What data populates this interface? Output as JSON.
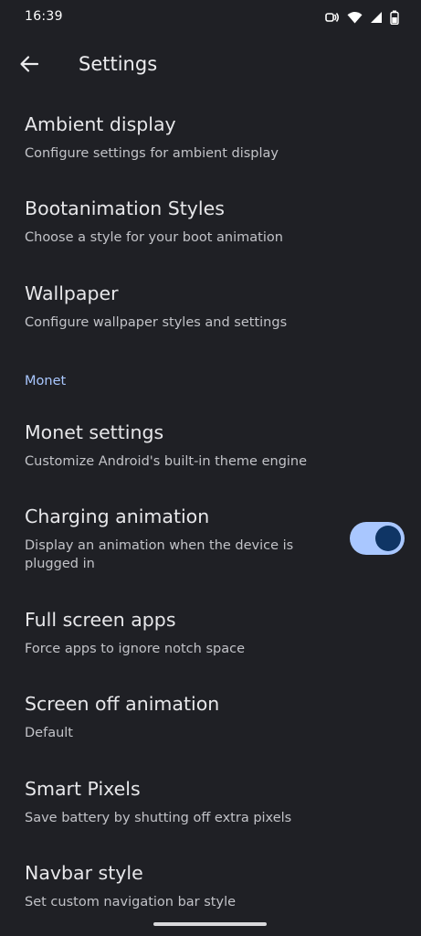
{
  "status_bar": {
    "time": "16:39",
    "icons": [
      "nfc-icon",
      "wifi-icon",
      "signal-icon",
      "battery-icon"
    ]
  },
  "toolbar": {
    "back_icon": "arrow-back-icon",
    "title": "Settings"
  },
  "preferences_top": [
    {
      "title": "Ambient display",
      "summary": "Configure settings for ambient display"
    },
    {
      "title": "Bootanimation Styles",
      "summary": "Choose a style for your boot animation"
    },
    {
      "title": "Wallpaper",
      "summary": "Configure wallpaper styles and settings"
    }
  ],
  "section": {
    "header": "Monet"
  },
  "preferences_monet": [
    {
      "title": "Monet settings",
      "summary": "Customize Android's built-in theme engine"
    },
    {
      "title": "Charging animation",
      "summary": "Display an animation when the device is plugged in",
      "switch_on": true
    },
    {
      "title": "Full screen apps",
      "summary": "Force apps to ignore notch space"
    },
    {
      "title": "Screen off animation",
      "summary": "Default"
    },
    {
      "title": "Smart Pixels",
      "summary": "Save battery by shutting off extra pixels"
    },
    {
      "title": "Navbar style",
      "summary": "Set custom navigation bar style"
    }
  ],
  "colors": {
    "background": "#1f2025",
    "accent": "#a9c7ff",
    "switch_thumb": "#0f3565"
  }
}
